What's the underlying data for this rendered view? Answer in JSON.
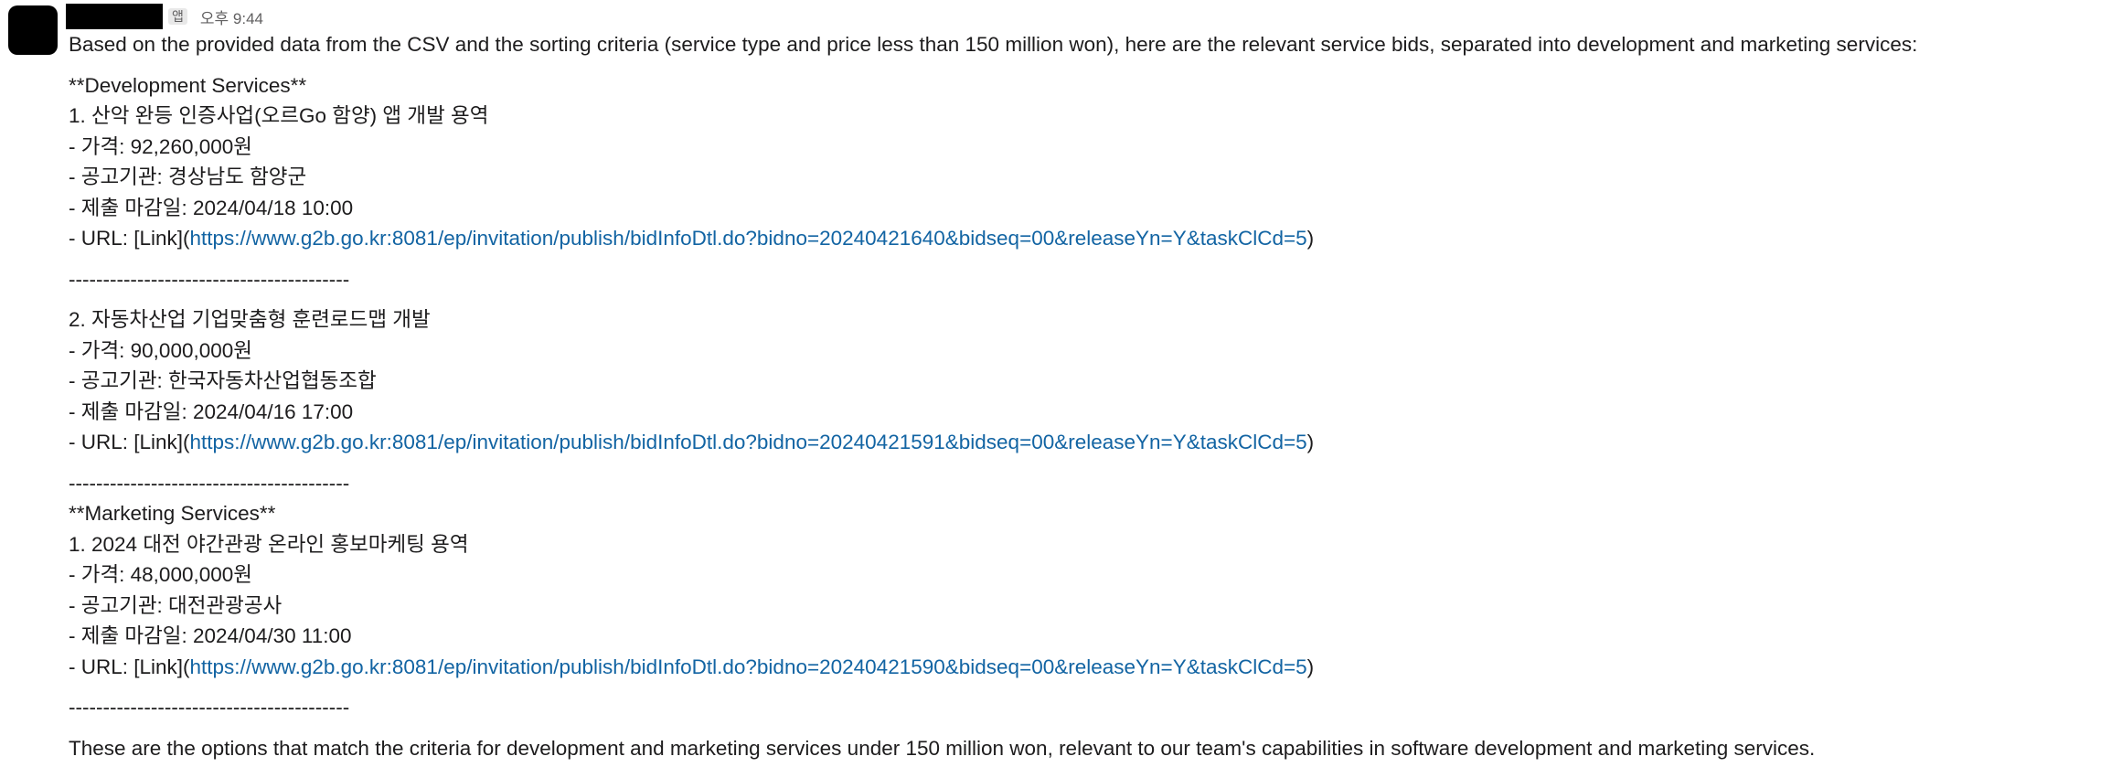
{
  "message": {
    "app_badge": "앱",
    "timestamp": "오후 9:44",
    "intro": "Based on the provided data from the CSV and the sorting criteria (service type and price less than 150 million won), here are the relevant service bids, separated into development and marketing services:",
    "dev_header": "**Development Services**",
    "dev_items": [
      {
        "title": "1. 산악 완등 인증사업(오르Go 함양) 앱 개발 용역",
        "price": "- 가격: 92,260,000원",
        "agency": "- 공고기관: 경상남도 함양군",
        "deadline": "- 제출 마감일: 2024/04/18 10:00",
        "url_prefix": "- URL: [Link](",
        "url": "https://www.g2b.go.kr:8081/ep/invitation/publish/bidInfoDtl.do?bidno=20240421640&bidseq=00&releaseYn=Y&taskClCd=5",
        "url_suffix": ")"
      },
      {
        "title": "2. 자동차산업 기업맞춤형 훈련로드맵 개발",
        "price": "- 가격: 90,000,000원",
        "agency": "- 공고기관: 한국자동차산업협동조합",
        "deadline": "- 제출 마감일: 2024/04/16 17:00",
        "url_prefix": "- URL: [Link](",
        "url": "https://www.g2b.go.kr:8081/ep/invitation/publish/bidInfoDtl.do?bidno=20240421591&bidseq=00&releaseYn=Y&taskClCd=5",
        "url_suffix": ")"
      }
    ],
    "separator": "-----------------------------------------",
    "mkt_header": "**Marketing Services**",
    "mkt_items": [
      {
        "title": "1. 2024 대전 야간관광 온라인 홍보마케팅 용역",
        "price": "- 가격: 48,000,000원",
        "agency": "- 공고기관: 대전관광공사",
        "deadline": "- 제출 마감일: 2024/04/30 11:00",
        "url_prefix": "- URL: [Link](",
        "url": "https://www.g2b.go.kr:8081/ep/invitation/publish/bidInfoDtl.do?bidno=20240421590&bidseq=00&releaseYn=Y&taskClCd=5",
        "url_suffix": ")"
      }
    ],
    "conclusion": "These are the options that match the criteria for development and marketing services under 150 million won, relevant to our team's capabilities in software development and marketing services."
  },
  "colors": {
    "link": "#1264a3",
    "text": "#1d1c1d",
    "muted": "#616061"
  }
}
